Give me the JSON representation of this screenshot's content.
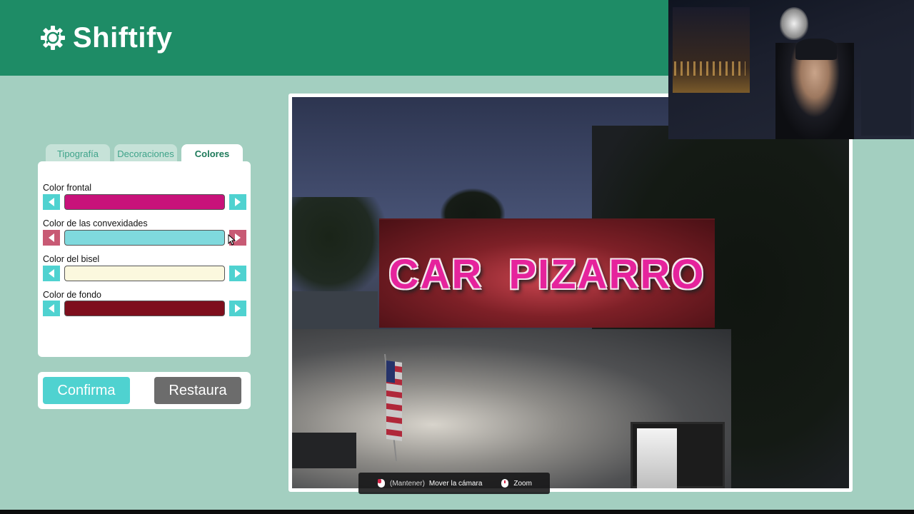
{
  "app": {
    "brand": "Shiftify",
    "logo_icon": "gear-refresh-icon"
  },
  "tabs": [
    {
      "label": "Tipografía",
      "active": false
    },
    {
      "label": "Decoraciones",
      "active": false
    },
    {
      "label": "Colores",
      "active": true
    }
  ],
  "colors_panel": {
    "rows": [
      {
        "label": "Color frontal",
        "color": "#c8127a"
      },
      {
        "label": "Color de las convexidades",
        "color": "#7fd9dd"
      },
      {
        "label": "Color del bisel",
        "color": "#fbf8de"
      },
      {
        "label": "Color de fondo",
        "color": "#7e0f1d"
      }
    ]
  },
  "actions": {
    "confirm_label": "Confirma",
    "restore_label": "Restaura"
  },
  "preview": {
    "sign_words": [
      "CAR",
      "PIZARRO"
    ]
  },
  "hint_bar": {
    "mouse_hint_key": "(Mantener)",
    "mouse_hint_action": "Mover la cámara",
    "zoom_hint": "Zoom"
  },
  "colors": {
    "header_green": "#1e8c66",
    "page_background": "#a3cfc0",
    "accent_cyan": "#4fd2d0",
    "button_gray": "#6c6c6c"
  }
}
